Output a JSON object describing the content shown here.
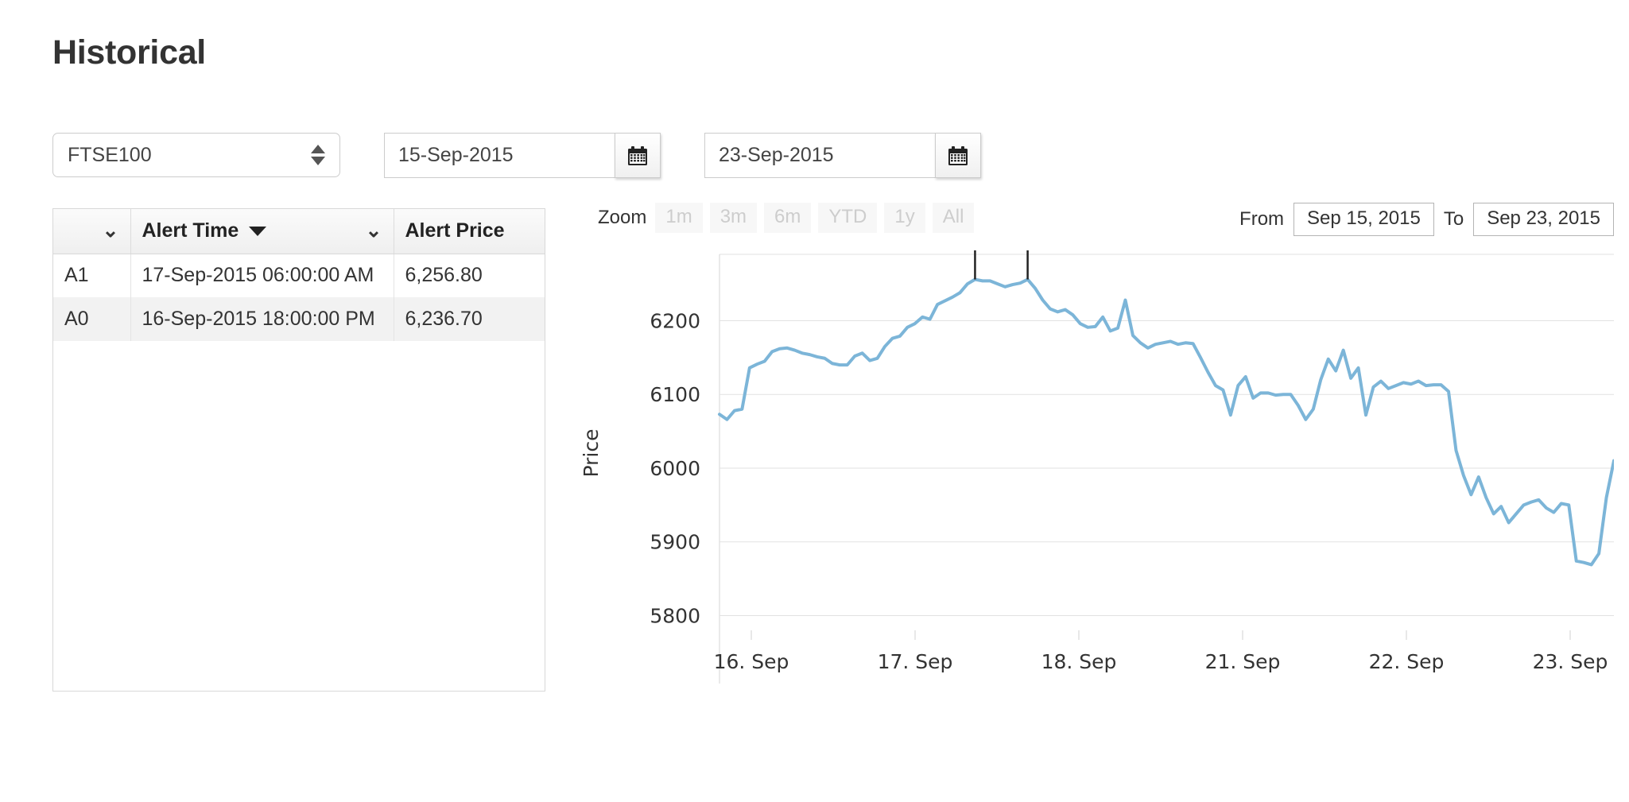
{
  "page": {
    "title": "Historical"
  },
  "filters": {
    "instrument": {
      "selected": "FTSE100",
      "options": [
        "FTSE100"
      ],
      "icon": "spinner-updown-icon"
    },
    "start_date": {
      "value": "15-Sep-2015",
      "calendar_icon": "calendar-icon"
    },
    "end_date": {
      "value": "23-Sep-2015",
      "calendar_icon": "calendar-icon"
    }
  },
  "alerts_table": {
    "columns": [
      {
        "label": "",
        "menu_icon": "chevron-down-icon"
      },
      {
        "label": "Alert Time",
        "sort_icon": "caret-down-icon",
        "menu_icon": "chevron-down-icon"
      },
      {
        "label": "Alert Price"
      }
    ],
    "rows": [
      {
        "id": "A1",
        "time": "17-Sep-2015 06:00:00 AM",
        "price": "6,256.80"
      },
      {
        "id": "A0",
        "time": "16-Sep-2015 18:00:00 PM",
        "price": "6,236.70"
      }
    ]
  },
  "chart_controls": {
    "zoom_label": "Zoom",
    "zoom_buttons": [
      "1m",
      "3m",
      "6m",
      "YTD",
      "1y",
      "All"
    ],
    "from_label": "From",
    "from_value": "Sep 15, 2015",
    "to_label": "To",
    "to_value": "Sep 23, 2015"
  },
  "chart_data": {
    "type": "line",
    "title": "",
    "xlabel": "",
    "ylabel": "Price",
    "ylim": [
      5780,
      6290
    ],
    "yticks": [
      5800,
      5900,
      6000,
      6100,
      6200
    ],
    "xticks": [
      "16. Sep",
      "17. Sep",
      "18. Sep",
      "21. Sep",
      "22. Sep",
      "23. Sep"
    ],
    "grid": true,
    "legend": false,
    "line_color": "#7cb5d8",
    "series": [
      {
        "name": "FTSE100",
        "values": [
          6073,
          6066,
          6078,
          6080,
          6136,
          6141,
          6145,
          6158,
          6162,
          6163,
          6160,
          6156,
          6154,
          6151,
          6149,
          6142,
          6140,
          6140,
          6152,
          6156,
          6146,
          6149,
          6165,
          6176,
          6179,
          6191,
          6196,
          6205,
          6202,
          6222,
          6227,
          6232,
          6238,
          6250,
          6256,
          6254,
          6254,
          6250,
          6246,
          6249,
          6251,
          6256,
          6244,
          6228,
          6216,
          6212,
          6215,
          6208,
          6196,
          6191,
          6192,
          6205,
          6186,
          6190,
          6228,
          6180,
          6170,
          6163,
          6168,
          6170,
          6172,
          6168,
          6170,
          6169,
          6150,
          6130,
          6112,
          6106,
          6072,
          6112,
          6124,
          6095,
          6102,
          6102,
          6099,
          6100,
          6100,
          6085,
          6066,
          6080,
          6120,
          6148,
          6132,
          6160,
          6122,
          6136,
          6072,
          6110,
          6118,
          6108,
          6112,
          6116,
          6114,
          6118,
          6112,
          6113,
          6113,
          6104,
          6024,
          5990,
          5964,
          5988,
          5960,
          5938,
          5948,
          5926,
          5938,
          5950,
          5954,
          5957,
          5946,
          5940,
          5952,
          5950,
          5874,
          5872,
          5869,
          5884,
          5960,
          6010
        ]
      }
    ],
    "annotations": [
      {
        "label": "A0",
        "x_index": 34,
        "value": 6236.7
      },
      {
        "label": "A1",
        "x_index": 41,
        "value": 6256.8
      }
    ]
  }
}
